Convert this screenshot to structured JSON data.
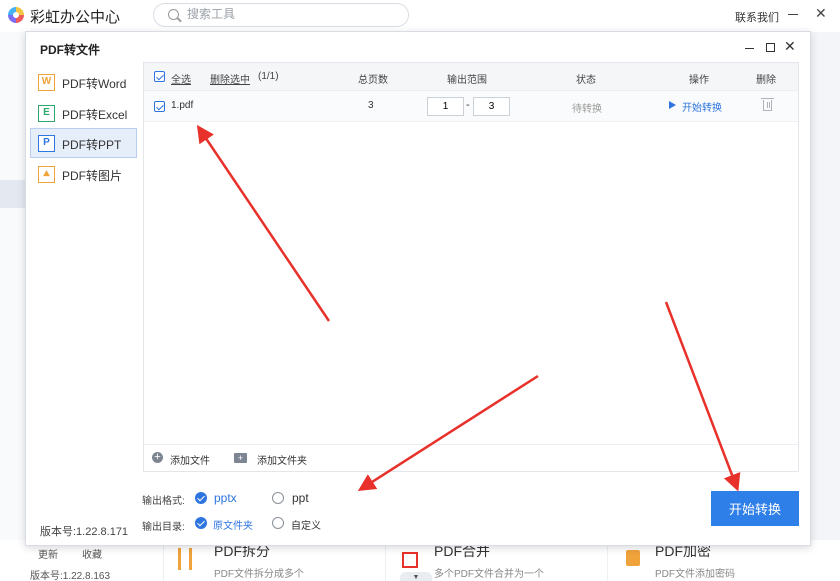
{
  "app": {
    "title": "彩虹办公中心",
    "search_placeholder": "搜索工具",
    "contact": "联系我们",
    "min_symbol": "—",
    "close_symbol": "✕"
  },
  "background": {
    "update_label": "更新",
    "fav_label": "收藏",
    "version": "版本号:1.22.8.163",
    "cards": [
      {
        "title": "PDF拆分",
        "desc": "PDF文件拆分成多个"
      },
      {
        "title": "PDF合并",
        "desc": "多个PDF文件合并为一个"
      },
      {
        "title": "PDF加密",
        "desc": "PDF文件添加密码"
      }
    ]
  },
  "dialog": {
    "title": "PDF转文件",
    "close_symbol": "✕",
    "sidebar": [
      {
        "icon_letter": "W",
        "label": "PDF转Word",
        "color": "#f0a23b"
      },
      {
        "icon_letter": "E",
        "label": "PDF转Excel",
        "color": "#2fa86b"
      },
      {
        "icon_letter": "P",
        "label": "PDF转PPT",
        "color": "#2f75e0"
      },
      {
        "icon_letter": "",
        "label": "PDF转图片",
        "color": "#f0a23b"
      }
    ],
    "version": "版本号:1.22.8.171",
    "list": {
      "select_all": "全选",
      "delete_selected": "删除选中",
      "count": "(1/1)",
      "col_pages": "总页数",
      "col_range": "输出范围",
      "col_status": "状态",
      "col_action": "操作",
      "col_delete": "删除",
      "rows": [
        {
          "name": "1.pdf",
          "pages": "3",
          "range_from": "1",
          "range_sep": "-",
          "range_to": "3",
          "status": "待转换",
          "action": "开始转换"
        }
      ],
      "add_file": "添加文件",
      "add_folder": "添加文件夹"
    },
    "output": {
      "format_label": "输出格式:",
      "format_options": [
        "pptx",
        "ppt"
      ],
      "format_selected": "pptx",
      "dir_label": "输出目录:",
      "dir_options": [
        "原文件夹",
        "自定义"
      ],
      "dir_selected": "原文件夹"
    },
    "start_button": "开始转换"
  },
  "colors": {
    "accent": "#2f75e0",
    "button": "#2f7fe8",
    "arrow": "#e8312a"
  }
}
